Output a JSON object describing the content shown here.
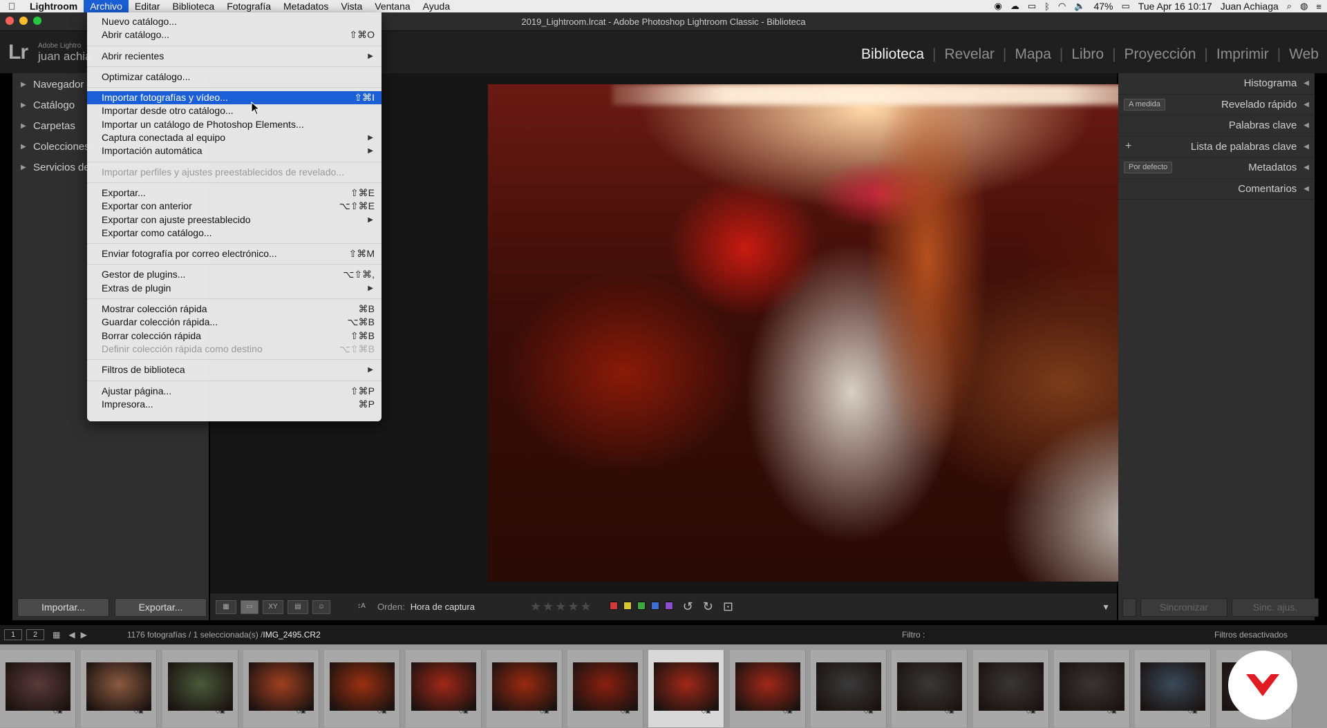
{
  "menubar": {
    "apple": "",
    "items": [
      "Lightroom",
      "Archivo",
      "Editar",
      "Biblioteca",
      "Fotografía",
      "Metadatos",
      "Vista",
      "Ventana",
      "Ayuda"
    ],
    "battery": "47%",
    "datetime": "Tue Apr 16  10:17",
    "user": "Juan Achiaga"
  },
  "window": {
    "title": "2019_Lightroom.lrcat - Adobe Photoshop Lightroom Classic - Biblioteca"
  },
  "identity": {
    "logo": "Lr",
    "small": "Adobe Lightro",
    "name": "juan achia"
  },
  "modules": [
    "Biblioteca",
    "Revelar",
    "Mapa",
    "Libro",
    "Proyección",
    "Imprimir",
    "Web"
  ],
  "left_panel": {
    "items": [
      "Navegador",
      "Catálogo",
      "Carpetas",
      "Colecciones",
      "Servicios de"
    ],
    "import_button": "Importar...",
    "export_button": "Exportar..."
  },
  "right_panel": {
    "items": [
      "Histograma",
      "Revelado rápido",
      "Palabras clave",
      "Lista de palabras clave",
      "Metadatos",
      "Comentarios"
    ],
    "quick_develop_select": "A medida",
    "metadata_select": "Por defecto",
    "sync_button": "Sincronizar",
    "sync_settings_button": "Sinc. ajus."
  },
  "toolbar": {
    "order_label": "Orden:",
    "order_value": "Hora de captura",
    "stars": "★★★★★",
    "colors": [
      "#d33a3a",
      "#d9c72e",
      "#3ea83e",
      "#3f6fd6",
      "#8a4fd0"
    ]
  },
  "filmstrip_header": {
    "box1": "1",
    "box2": "2",
    "info_prefix": "1176 fotografías / 1 seleccionada(s) /",
    "info_file": "IMG_2495.CR2",
    "filter_label": "Filtro :",
    "filters_off": "Filtros desactivados"
  },
  "file_menu": {
    "items": [
      {
        "label": "Nuevo catálogo...",
        "shortcut": ""
      },
      {
        "label": "Abrir catálogo...",
        "shortcut": "⇧⌘O"
      },
      {
        "sep": true
      },
      {
        "label": "Abrir recientes",
        "submenu": true
      },
      {
        "sep": true
      },
      {
        "label": "Optimizar catálogo...",
        "shortcut": ""
      },
      {
        "sep": true
      },
      {
        "label": "Importar fotografías y vídeo...",
        "shortcut": "⇧⌘I",
        "highlighted": true
      },
      {
        "label": "Importar desde otro catálogo...",
        "shortcut": ""
      },
      {
        "label": "Importar un catálogo de Photoshop Elements...",
        "shortcut": ""
      },
      {
        "label": "Captura conectada al equipo",
        "submenu": true
      },
      {
        "label": "Importación automática",
        "submenu": true
      },
      {
        "sep": true
      },
      {
        "label": "Importar perfiles y ajustes preestablecidos de revelado...",
        "disabled": true
      },
      {
        "sep": true
      },
      {
        "label": "Exportar...",
        "shortcut": "⇧⌘E"
      },
      {
        "label": "Exportar con anterior",
        "shortcut": "⌥⇧⌘E"
      },
      {
        "label": "Exportar con ajuste preestablecido",
        "submenu": true
      },
      {
        "label": "Exportar como catálogo...",
        "shortcut": ""
      },
      {
        "sep": true
      },
      {
        "label": "Enviar fotografía por correo electrónico...",
        "shortcut": "⇧⌘M"
      },
      {
        "sep": true
      },
      {
        "label": "Gestor de plugins...",
        "shortcut": "⌥⇧⌘,"
      },
      {
        "label": "Extras de plugin",
        "submenu": true
      },
      {
        "sep": true
      },
      {
        "label": "Mostrar colección rápida",
        "shortcut": "⌘B"
      },
      {
        "label": "Guardar colección rápida...",
        "shortcut": "⌥⌘B"
      },
      {
        "label": "Borrar colección rápida",
        "shortcut": "⇧⌘B"
      },
      {
        "label": "Definir colección rápida como destino",
        "shortcut": "⌥⇧⌘B",
        "disabled": true
      },
      {
        "sep": true
      },
      {
        "label": "Filtros de biblioteca",
        "submenu": true
      },
      {
        "sep": true
      },
      {
        "label": "Ajustar página...",
        "shortcut": "⇧⌘P"
      },
      {
        "label": "Impresora...",
        "shortcut": "⌘P"
      }
    ]
  },
  "filmstrip": {
    "thumb_colors": [
      "#5a3a3a",
      "#8a5a40",
      "#4a5a3a",
      "#a04020",
      "#9a3010",
      "#a02818",
      "#9a2a10",
      "#8a2010",
      "#a02818",
      "#a02818",
      "#3a3a3a",
      "#3a3838",
      "#3a3636",
      "#3a3434",
      "#3a4a5a",
      "#2a2a2a"
    ],
    "selected_index": 8
  }
}
